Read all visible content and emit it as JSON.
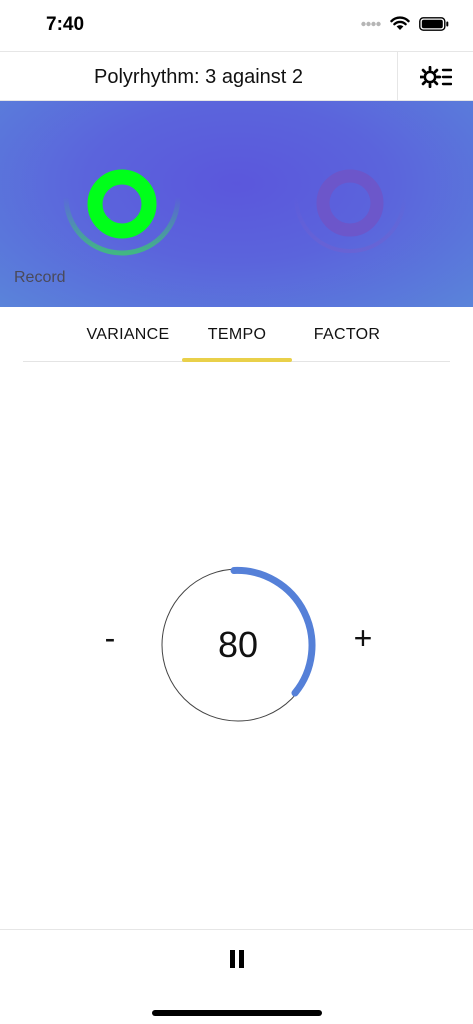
{
  "status_bar": {
    "time": "7:40",
    "icons": [
      "signal-dots-icon",
      "wifi-icon",
      "battery-icon"
    ]
  },
  "header": {
    "title": "Polyrhythm: 3 against 2",
    "settings_icon": "settings-list-icon"
  },
  "visualizer": {
    "record_label": "Record",
    "colors": {
      "active_pulse": "#00ff1a",
      "inactive_pulse": "#6e55c8",
      "background": "#5b5fdc"
    }
  },
  "tabs": {
    "items": [
      {
        "label": "VARIANCE"
      },
      {
        "label": "TEMPO"
      },
      {
        "label": "FACTOR"
      }
    ],
    "active": "TEMPO",
    "indicator_color": "#e9d04a"
  },
  "tempo": {
    "value": "80",
    "minus_label": "-",
    "plus_label": "+",
    "arc_color": "#5580d8"
  },
  "controls": {
    "pause_icon": "pause-icon"
  }
}
